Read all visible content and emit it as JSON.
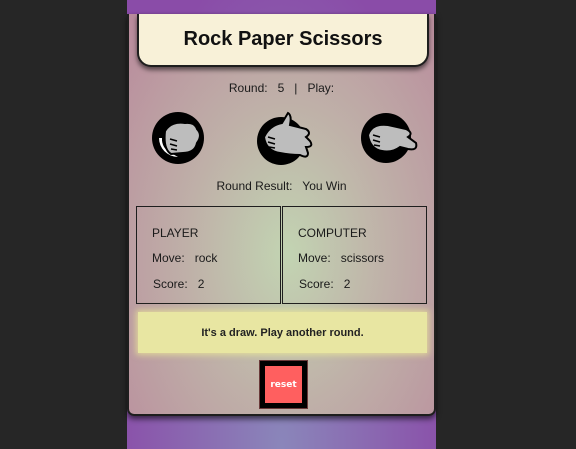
{
  "header": {
    "title": "Rock Paper Scissors"
  },
  "status": {
    "round_label": "Round:",
    "round_value": "5",
    "separator": "|",
    "play_label": "Play:"
  },
  "choices": [
    {
      "name": "rock",
      "icon": "rock-hand-icon"
    },
    {
      "name": "paper",
      "icon": "paper-hand-icon"
    },
    {
      "name": "scissors",
      "icon": "scissors-hand-icon"
    }
  ],
  "round_result": {
    "label": "Round Result:",
    "value": "You Win"
  },
  "player": {
    "heading": "PLAYER",
    "move_label": "Move:",
    "move": "rock",
    "score_label": "Score:",
    "score": "2"
  },
  "computer": {
    "heading": "COMPUTER",
    "move_label": "Move:",
    "move": "scissors",
    "score_label": "Score:",
    "score": "2"
  },
  "message": "It's a draw. Play another round.",
  "reset_label": "reset",
  "colors": {
    "background": "#262626",
    "title_bg": "#f8f1d8",
    "banner": "#e8e6a2",
    "reset": "#ff5f5f"
  }
}
